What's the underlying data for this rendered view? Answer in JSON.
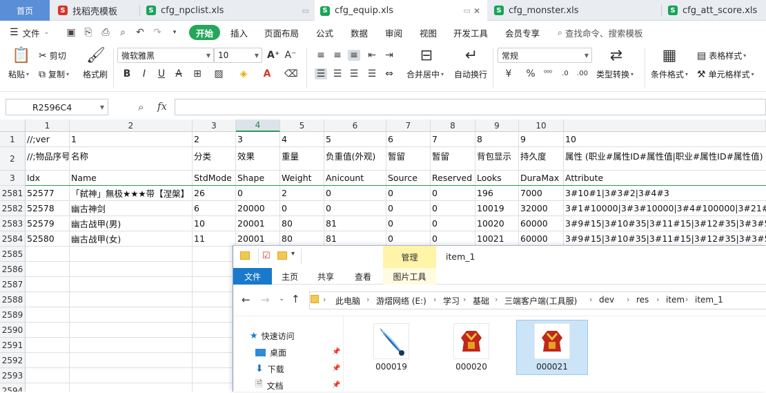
{
  "tabs": [
    {
      "label": "首页"
    },
    {
      "label": "找稻壳模板",
      "icon": "docer-icon"
    },
    {
      "label": "cfg_npclist.xls",
      "icon": "sheet-icon"
    },
    {
      "label": "cfg_equip.xls",
      "icon": "sheet-icon",
      "active": true
    },
    {
      "label": "cfg_monster.xls",
      "icon": "sheet-icon"
    },
    {
      "label": "cfg_att_score.xls",
      "icon": "sheet-icon"
    }
  ],
  "menu": {
    "file": "文件",
    "items": [
      "开始",
      "插入",
      "页面布局",
      "公式",
      "数据",
      "审阅",
      "视图",
      "开发工具",
      "会员专享"
    ],
    "search": "查找命令、搜索模板"
  },
  "ribbon": {
    "paste": "粘贴",
    "cut": "剪切",
    "copy": "复制",
    "format_painter": "格式刷",
    "font": "微软雅黑",
    "font_size": "10",
    "merge_center": "合并居中",
    "wrap_text": "自动换行",
    "number_format": "常规",
    "type_convert": "类型转换",
    "conditional_format": "条件格式",
    "table_style": "表格样式",
    "cell_style": "单元格样式",
    "accent": "#26a65b"
  },
  "formula": {
    "name_box": "R2596C4",
    "fx": "fx",
    "content": ""
  },
  "grid": {
    "col_headers": [
      "1",
      "2",
      "3",
      "4",
      "5",
      "6",
      "7",
      "8",
      "9",
      "10"
    ],
    "selected_col": "4",
    "rows": [
      {
        "num": "1",
        "cells": [
          "//;ver",
          "1",
          "2",
          "3",
          "4",
          "5",
          "6",
          "7",
          "8",
          "9",
          "10"
        ]
      },
      {
        "num": "2",
        "cells": [
          "//;物品序号",
          "名称",
          "分类",
          "效果",
          "重量",
          "负重值(外观)",
          "暂留",
          "暂留",
          "背包显示",
          "持久度",
          "属性 (职业#属性ID#属性值|职业#属性ID#属性值)"
        ]
      },
      {
        "num": "3",
        "cells": [
          "Idx",
          "Name",
          "StdMode",
          "Shape",
          "Weight",
          "Anicount",
          "Source",
          "Reserved",
          "Looks",
          "DuraMax",
          "Attribute"
        ]
      },
      {
        "num": "2581",
        "cells": [
          "52577",
          "「弑神」無极★★★带【涅槃】",
          "26",
          "0",
          "2",
          "0",
          "0",
          "0",
          "196",
          "7000",
          "3#10#1|3#3#2|3#4#3"
        ]
      },
      {
        "num": "2582",
        "cells": [
          "52578",
          "幽古神剑",
          "6",
          "20000",
          "0",
          "0",
          "0",
          "0",
          "10019",
          "32000",
          "3#1#10000|3#3#10000|3#4#100000|3#21#10"
        ]
      },
      {
        "num": "2583",
        "cells": [
          "52579",
          "幽古战甲(男)",
          "10",
          "20001",
          "80",
          "81",
          "0",
          "0",
          "10020",
          "60000",
          "3#9#15|3#10#35|3#11#15|3#12#35|3#3#50|3"
        ]
      },
      {
        "num": "2584",
        "cells": [
          "52580",
          "幽古战甲(女)",
          "11",
          "20001",
          "80",
          "81",
          "0",
          "0",
          "10021",
          "60000",
          "3#9#15|3#10#35|3#11#15|3#12#35|3#3#50|3"
        ]
      },
      {
        "num": "2585",
        "cells": []
      },
      {
        "num": "2586",
        "cells": []
      },
      {
        "num": "2587",
        "cells": []
      },
      {
        "num": "2588",
        "cells": []
      },
      {
        "num": "2589",
        "cells": []
      },
      {
        "num": "2590",
        "cells": []
      },
      {
        "num": "2591",
        "cells": []
      },
      {
        "num": "2592",
        "cells": []
      },
      {
        "num": "2593",
        "cells": []
      },
      {
        "num": "2594",
        "cells": []
      }
    ]
  },
  "explorer": {
    "title": "item_1",
    "manage": "管理",
    "tabs": [
      "文件",
      "主页",
      "共享",
      "查看",
      "图片工具"
    ],
    "path": [
      "此电脑",
      "游熠网络 (E:)",
      "学习",
      "基础",
      "三端客户端(工具服)",
      "dev",
      "res",
      "item",
      "item_1"
    ],
    "nav": [
      {
        "label": "快速访问",
        "icon": "star-icon"
      },
      {
        "label": "桌面",
        "icon": "desktop-icon"
      },
      {
        "label": "下载",
        "icon": "download-icon"
      },
      {
        "label": "文档",
        "icon": "document-icon"
      }
    ],
    "files": [
      {
        "name": "000019"
      },
      {
        "name": "000020"
      },
      {
        "name": "000021",
        "selected": true
      }
    ]
  }
}
